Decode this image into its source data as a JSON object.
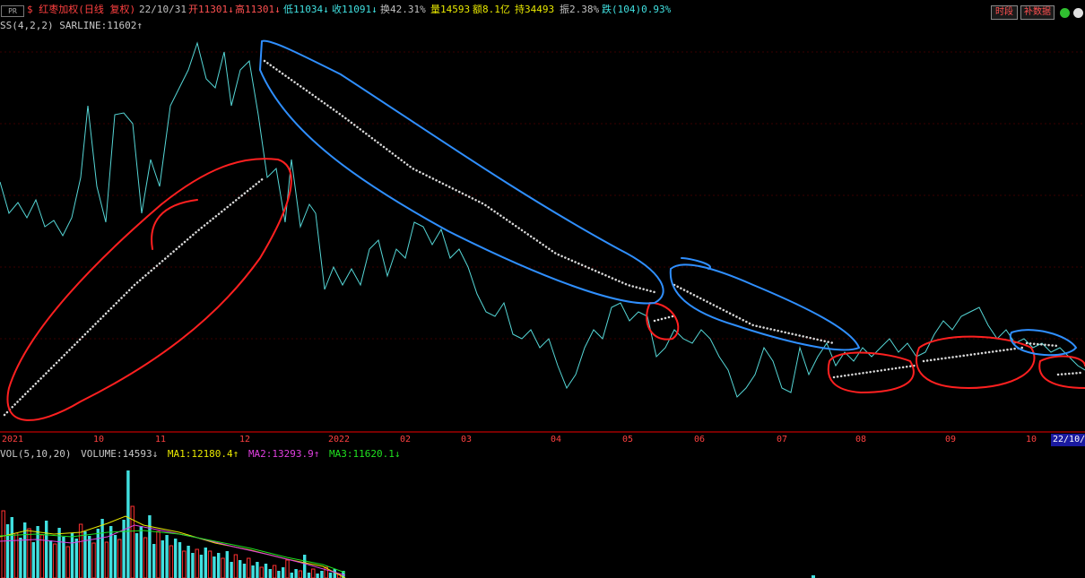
{
  "header": {
    "badge": "PR",
    "title": "$ 红枣加权(日线 复权)",
    "date": "22/10/31",
    "open": "开11301↓",
    "high": "高11301↓",
    "low": "低11034↓",
    "close": "收11091↓",
    "turnover": "换42.31%",
    "volume": "量14593",
    "amount": "额8.1亿",
    "hold": "持34493",
    "amplitude": "振2.38%",
    "change": "跌(104)0.93%",
    "btn_period": "时段",
    "btn_fill": "补数据"
  },
  "indicator": {
    "label": "SS(4,2,2)  SARLINE:11602↑"
  },
  "axis": {
    "ticks": [
      "2021",
      "10",
      "11",
      "12",
      "2022",
      "02",
      "03",
      "04",
      "05",
      "06",
      "07",
      "08",
      "09",
      "10",
      "22/10/"
    ]
  },
  "volume_panel": {
    "vol": "VOL(5,10,20)",
    "volume": "VOLUME:14593↓",
    "ma1": "MA1:12180.4↑",
    "ma2": "MA2:13293.9↑",
    "ma3": "MA3:11620.1↓"
  },
  "colors": {
    "price": "#55d6d6",
    "sar": "#d8d8d8",
    "red_mark": "#ff2020",
    "blue_mark": "#2f8fff",
    "ma1": "#e8e800",
    "ma2": "#e040e0",
    "ma3": "#20e020",
    "vol_up": "#ff3030",
    "vol_down": "#40e0e0"
  }
}
